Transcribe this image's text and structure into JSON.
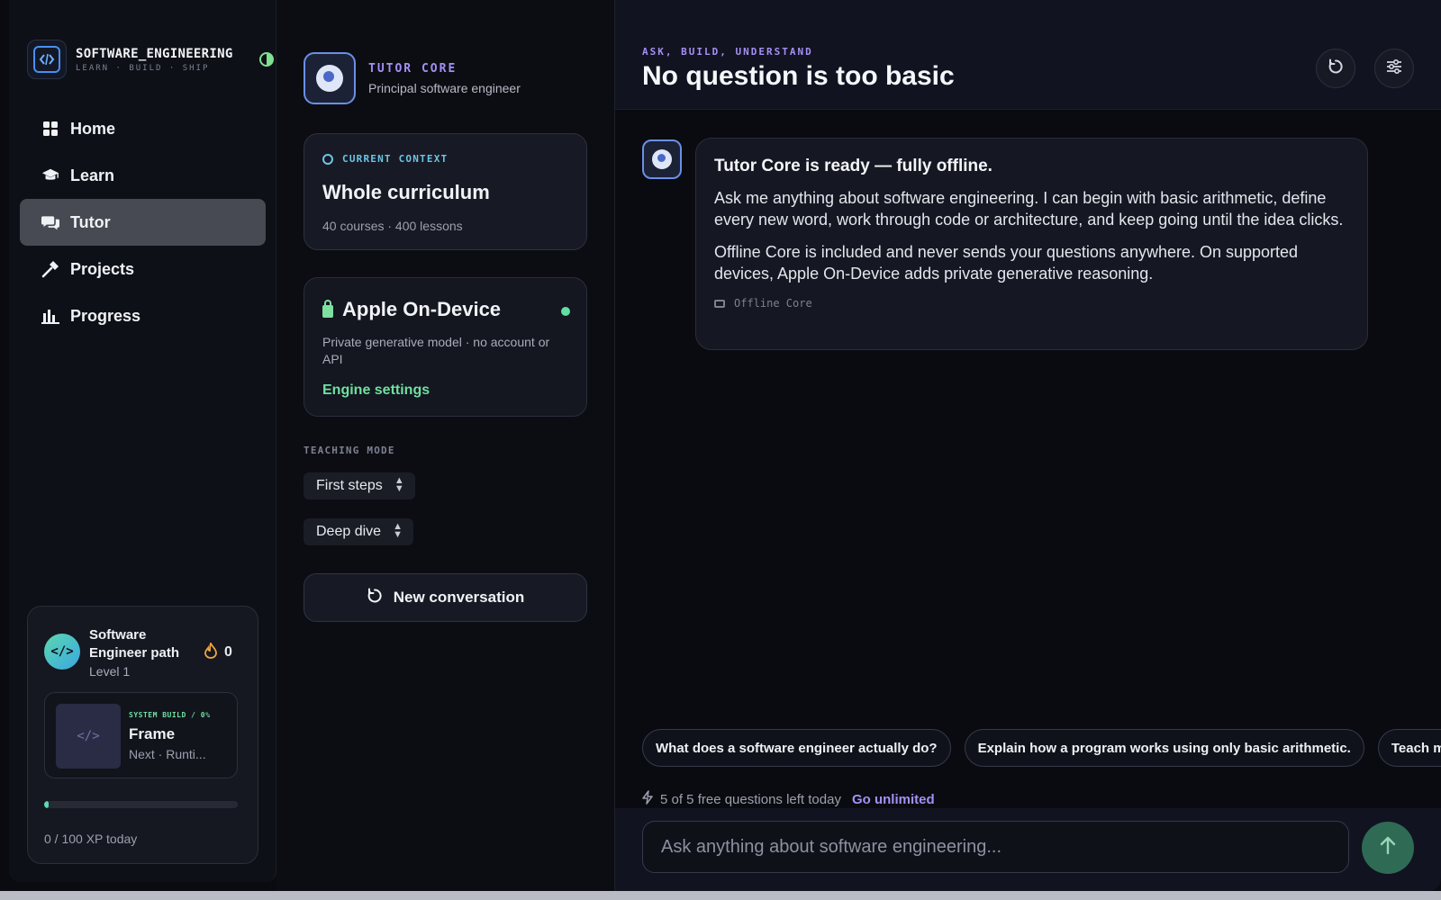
{
  "brand": {
    "title": "SOFTWARE_ENGINEERING",
    "subtitle": "LEARN · BUILD · SHIP"
  },
  "nav": [
    {
      "label": "Home",
      "icon": "grid-icon"
    },
    {
      "label": "Learn",
      "icon": "graduation-cap-icon"
    },
    {
      "label": "Tutor",
      "icon": "chat-bubbles-icon",
      "active": true
    },
    {
      "label": "Projects",
      "icon": "hammer-icon"
    },
    {
      "label": "Progress",
      "icon": "bar-chart-icon"
    }
  ],
  "path_card": {
    "avatar_text": "</>",
    "title": "Software Engineer path",
    "level": "Level 1",
    "streak": "0",
    "build_tag": "SYSTEM BUILD / 0%",
    "build_name": "Frame",
    "build_next": "Next · Runti...",
    "build_thumb_text": "</>",
    "xp_text": "0 / 100 XP today",
    "xp_progress": 0
  },
  "tutor": {
    "name": "TUTOR CORE",
    "role": "Principal software engineer"
  },
  "context": {
    "label": "CURRENT CONTEXT",
    "title": "Whole curriculum",
    "meta": "40 courses · 400 lessons"
  },
  "engine": {
    "title": "Apple On-Device",
    "description": "Private generative model · no account or API",
    "link": "Engine settings",
    "status_color": "#5ee0a0"
  },
  "teaching": {
    "label": "TEACHING MODE",
    "mode_1": "First steps",
    "mode_2": "Deep dive"
  },
  "new_conversation": "New conversation",
  "header": {
    "eyebrow": "ASK, BUILD, UNDERSTAND",
    "title": "No question is too basic"
  },
  "message": {
    "heading": "Tutor Core is ready — fully offline.",
    "p1": "Ask me anything about software engineering. I can begin with basic arithmetic, define every new word, work through code or architecture, and keep going until the idea clicks.",
    "p2": "Offline Core is included and never sends your questions anywhere. On supported devices, Apple On-Device adds private generative reasoning.",
    "source": "Offline Core"
  },
  "suggestions": [
    "What does a software engineer actually do?",
    "Explain how a program works using only basic arithmetic.",
    "Teach me"
  ],
  "quota": {
    "text": "5 of 5 free questions left today",
    "link": "Go unlimited"
  },
  "composer": {
    "placeholder": "Ask anything about software engineering..."
  },
  "colors": {
    "accent_purple": "#a490f5",
    "accent_green": "#6fe0a0",
    "active_nav": "#474a52"
  }
}
